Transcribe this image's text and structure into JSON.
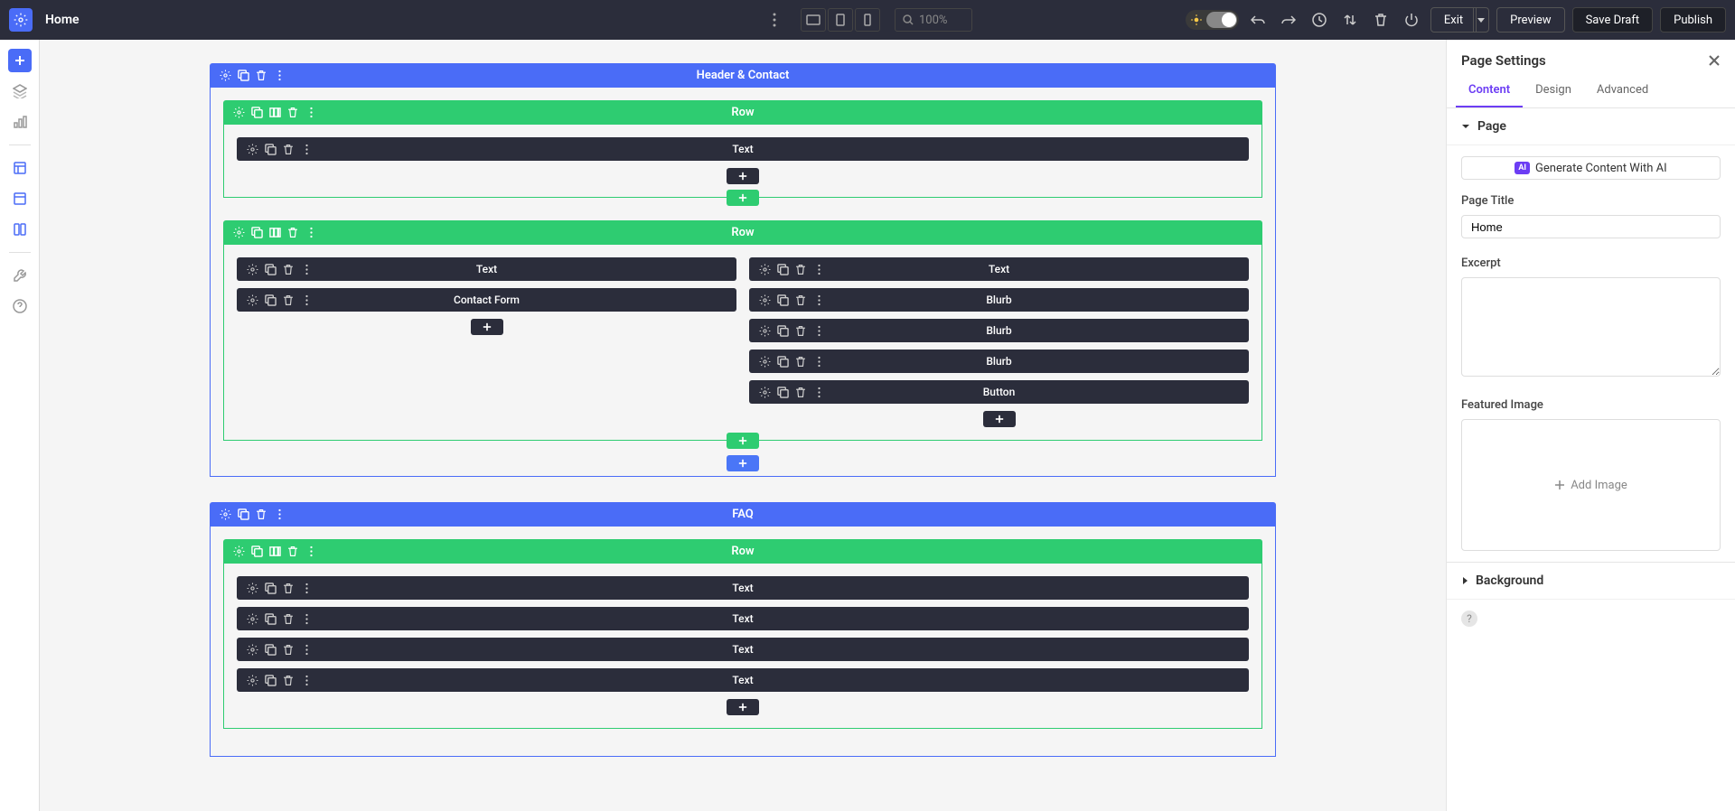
{
  "topbar": {
    "page_name": "Home",
    "zoom": "100%",
    "exit": "Exit",
    "preview": "Preview",
    "save_draft": "Save Draft",
    "publish": "Publish"
  },
  "canvas": {
    "sections": [
      {
        "label": "Header & Contact",
        "rows": [
          {
            "label": "Row",
            "cols": [
              {
                "modules": [
                  "Text"
                ]
              }
            ]
          },
          {
            "label": "Row",
            "cols": [
              {
                "modules": [
                  "Text",
                  "Contact Form"
                ]
              },
              {
                "modules": [
                  "Text",
                  "Blurb",
                  "Blurb",
                  "Blurb",
                  "Button"
                ]
              }
            ]
          }
        ]
      },
      {
        "label": "FAQ",
        "rows": [
          {
            "label": "Row",
            "cols": [
              {
                "modules": [
                  "Text",
                  "Text",
                  "Text",
                  "Text"
                ]
              }
            ]
          }
        ]
      }
    ]
  },
  "rp": {
    "title": "Page Settings",
    "tabs": {
      "content": "Content",
      "design": "Design",
      "advanced": "Advanced"
    },
    "page_group": "Page",
    "ai_btn": "Generate Content With AI",
    "ai_badge": "AI",
    "page_title_label": "Page Title",
    "page_title_value": "Home",
    "excerpt_label": "Excerpt",
    "featured_label": "Featured Image",
    "add_image": "Add Image",
    "background_group": "Background"
  }
}
